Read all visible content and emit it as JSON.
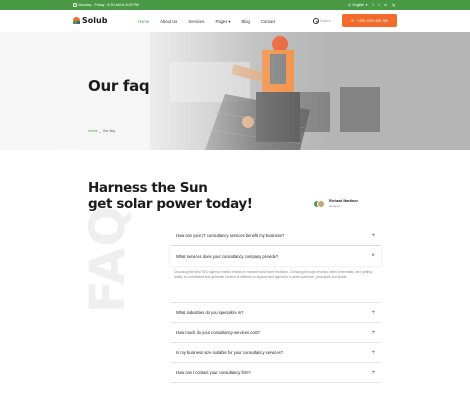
{
  "topbar": {
    "hours": "Monday - Friday : 8.30 AM to 8.00 PM",
    "language": "English",
    "social": [
      "f",
      "t",
      "in",
      "ig"
    ]
  },
  "header": {
    "logo": "Solub",
    "nav": [
      "Home",
      "About Us",
      "Services",
      "Pages",
      "Blog",
      "Contact"
    ],
    "search_placeholder": "Search ...",
    "cta": "+ 000 1234 456 789"
  },
  "hero": {
    "title": "Our faq",
    "breadcrumb_home": "Home",
    "breadcrumb_sep": "_",
    "breadcrumb_current": "Our faq"
  },
  "main": {
    "headline_line1": "Harness the Sun",
    "headline_line2": "get solar power today!",
    "author_name": "Richard Martinez",
    "author_role": "Designer",
    "watermark": "FAQ"
  },
  "faq": [
    {
      "q": "How can your IT consultancy services benefit my business?",
      "open": false
    },
    {
      "q": "What services does your consultancy company provide?",
      "open": true,
      "a": "Choosing the best SEO Agency means research, research and more research. Checking through reviews, team credentials, and getting. Ability to understand and generate content is different to expand and appeal to a wider audience, proposals and audits."
    },
    {
      "q": "What industries do you specialize in?",
      "open": false
    },
    {
      "q": "How much do your consultancy services cost?",
      "open": false
    },
    {
      "q": "Is my business size suitable for your consultancy services?",
      "open": false
    },
    {
      "q": "How can I contact your consultancy firm?",
      "open": false
    }
  ],
  "colors": {
    "brand_green": "#4a9a45",
    "brand_orange": "#f26b2a"
  }
}
